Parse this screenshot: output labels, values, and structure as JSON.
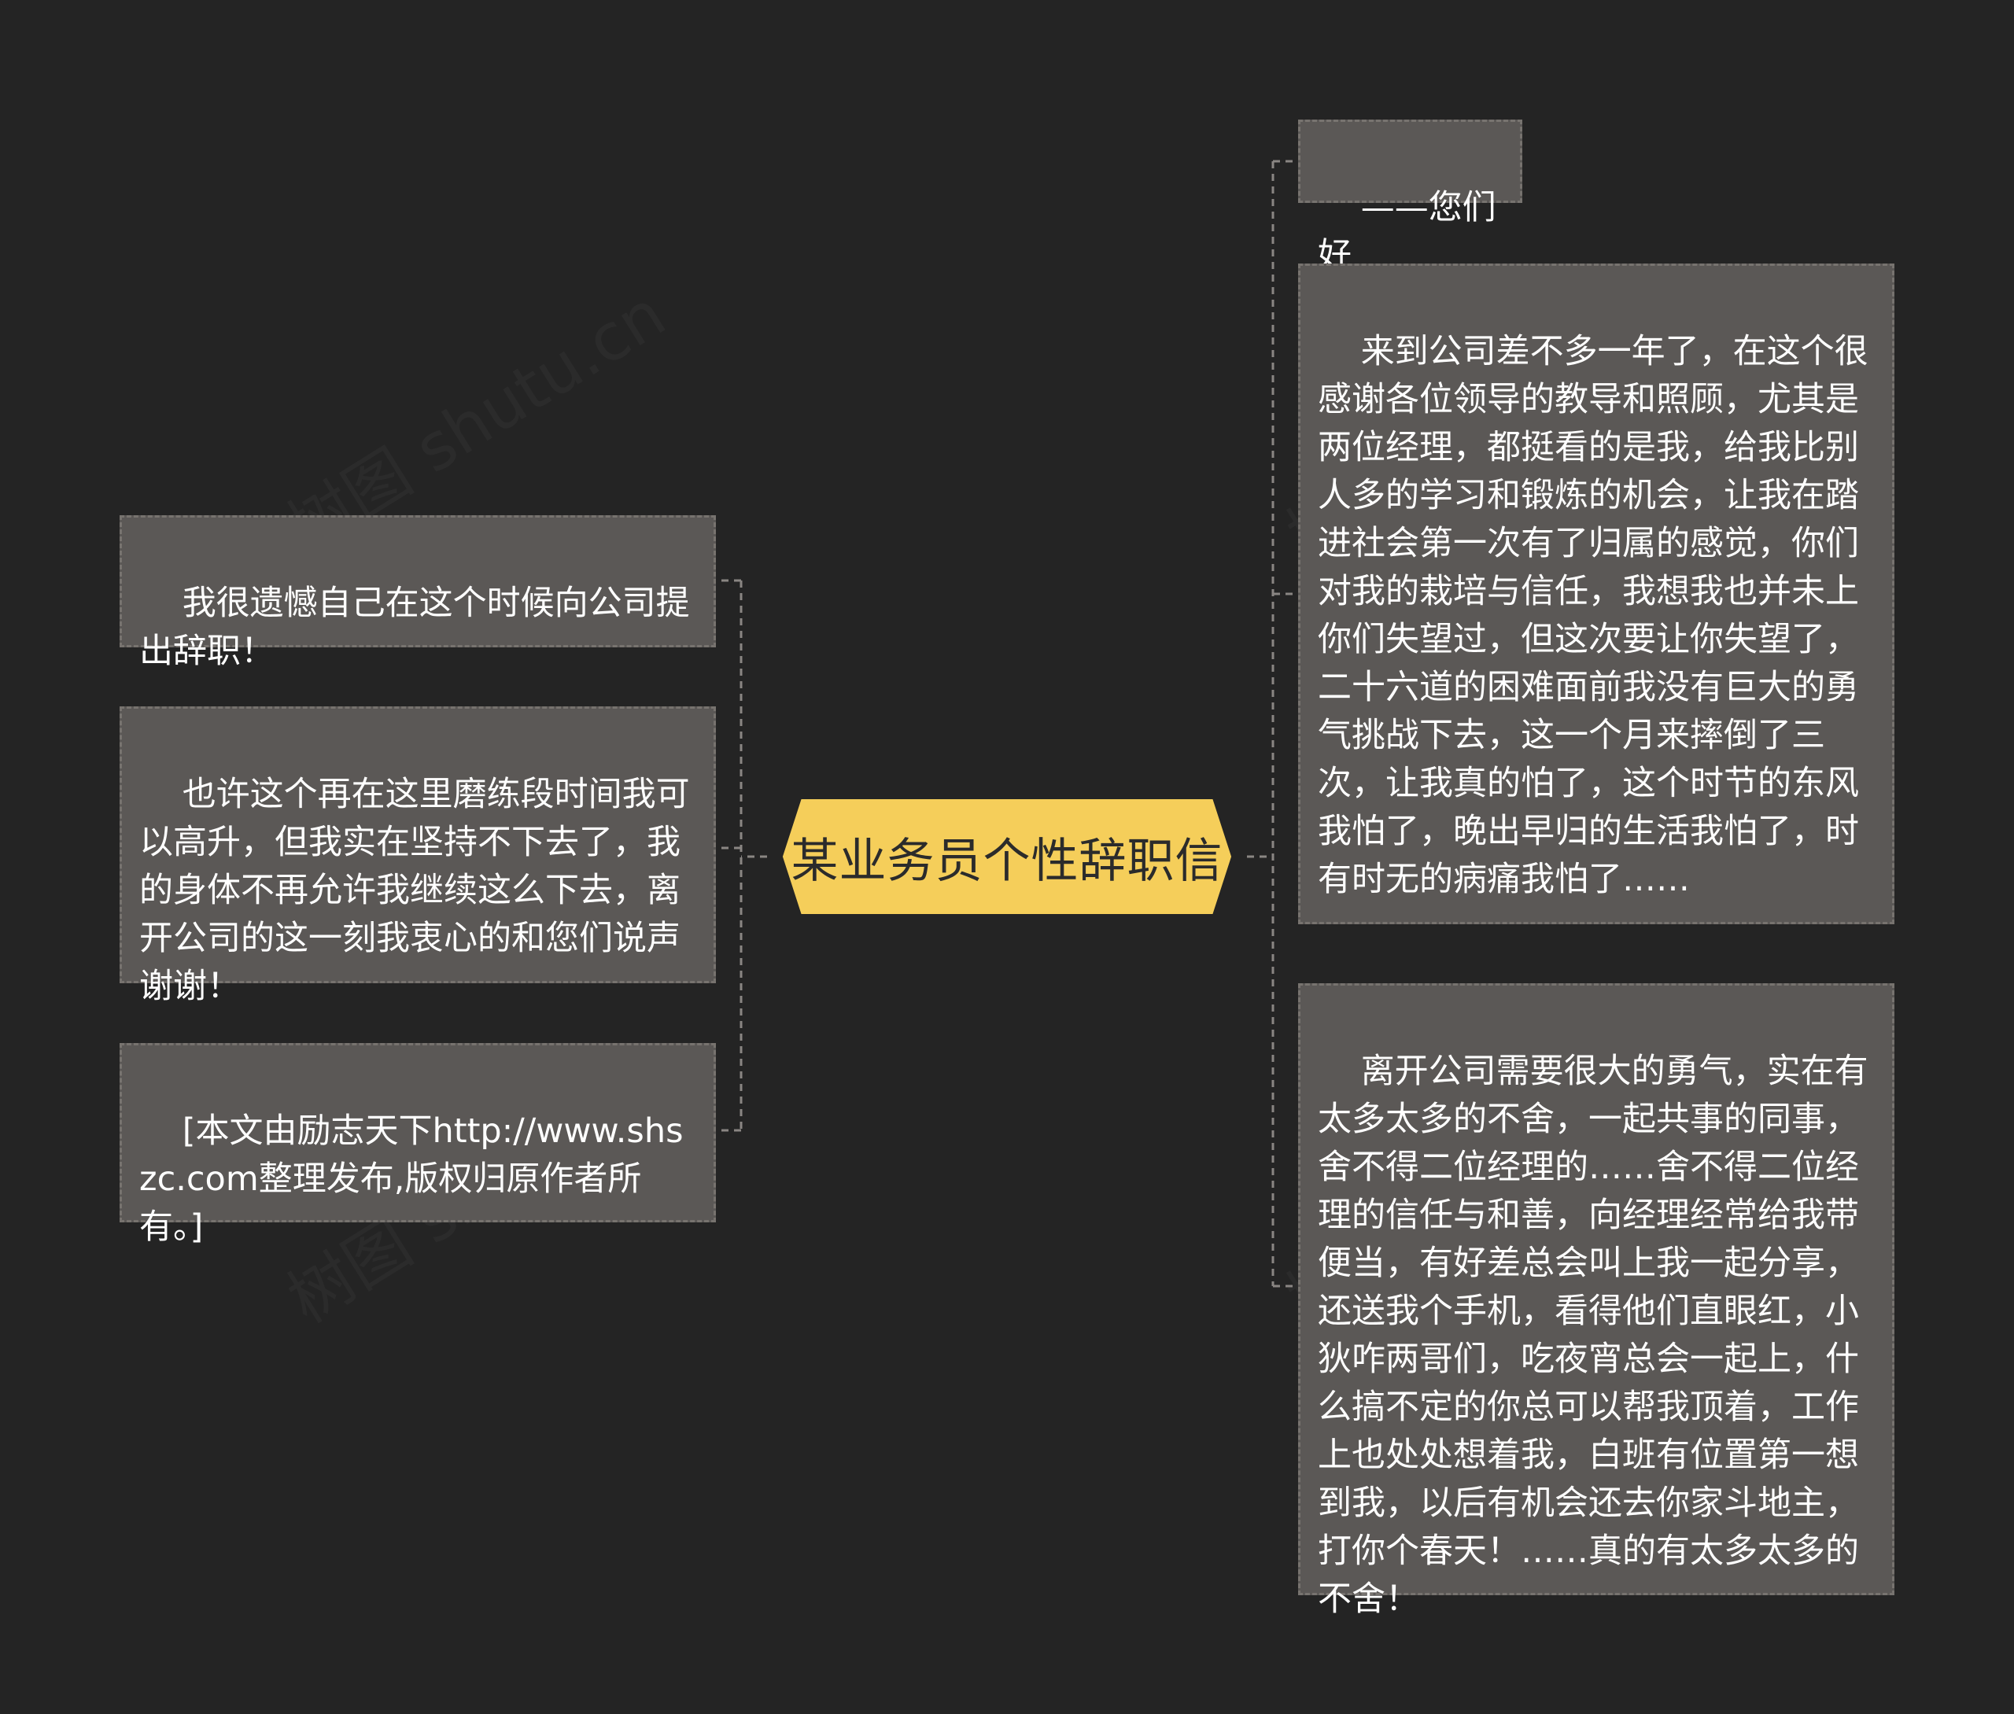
{
  "root": {
    "label": "某业务员个性辞职信",
    "fill_color": "#f5ce5a",
    "border_color": "#f5ce5a"
  },
  "colors": {
    "background": "#242424",
    "node_fill": "#5b5856",
    "node_border": "#77736f",
    "connector": "#8a8683",
    "node_text": "#ffffff"
  },
  "right_nodes": [
    {
      "text": "——您们好"
    },
    {
      "text": "来到公司差不多一年了，在这个很感谢各位领导的教导和照顾，尤其是两位经理，都挺看的是我，给我比别人多的学习和锻炼的机会，让我在踏进社会第一次有了归属的感觉，你们对我的栽培与信任，我想我也并未上你们失望过，但这次要让你失望了，二十六道的困难面前我没有巨大的勇气挑战下去，这一个月来摔倒了三次，让我真的怕了，这个时节的东风我怕了，晚出早归的生活我怕了，时有时无的病痛我怕了……"
    },
    {
      "text": "离开公司需要很大的勇气，实在有太多太多的不舍，一起共事的同事，舍不得二位经理的……舍不得二位经理的信任与和善，向经理经常给我带便当，有好差总会叫上我一起分享，还送我个手机，看得他们直眼红，小狄咋两哥们，吃夜宵总会一起上，什么搞不定的你总可以帮我顶着，工作上也处处想着我，白班有位置第一想到我，以后有机会还去你家斗地主，打你个春天！……真的有太多太多的不舍！"
    }
  ],
  "left_nodes": [
    {
      "text": "我很遗憾自己在这个时候向公司提出辞职！"
    },
    {
      "text": "也许这个再在这里磨练段时间我可以高升，但我实在坚持不下去了，我的身体不再允许我继续这么下去，离开公司的这一刻我衷心的和您们说声谢谢！"
    },
    {
      "text": "[本文由励志天下http://www.shszc.com整理发布,版权归原作者所有。]"
    }
  ]
}
